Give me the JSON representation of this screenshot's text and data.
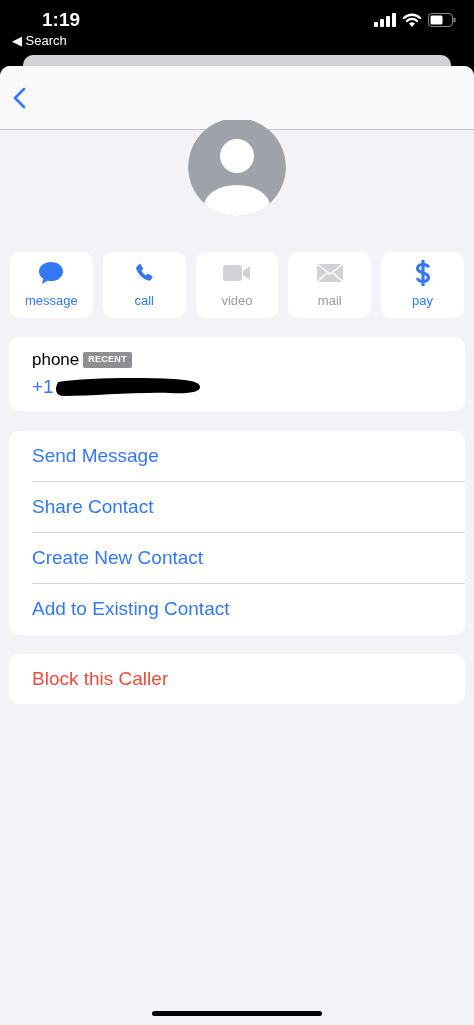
{
  "status_bar": {
    "time": "1:19",
    "back_label": "◀ Search"
  },
  "actions": [
    {
      "kind": "message",
      "label": "message",
      "disabled": false
    },
    {
      "kind": "call",
      "label": "call",
      "disabled": false
    },
    {
      "kind": "video",
      "label": "video",
      "disabled": true
    },
    {
      "kind": "mail",
      "label": "mail",
      "disabled": true
    },
    {
      "kind": "pay",
      "label": "pay",
      "disabled": false
    }
  ],
  "phone": {
    "label": "phone",
    "badge": "RECENT",
    "number": "+1"
  },
  "menu": [
    "Send Message",
    "Share Contact",
    "Create New Contact",
    "Add to Existing Contact"
  ],
  "block": "Block this Caller"
}
